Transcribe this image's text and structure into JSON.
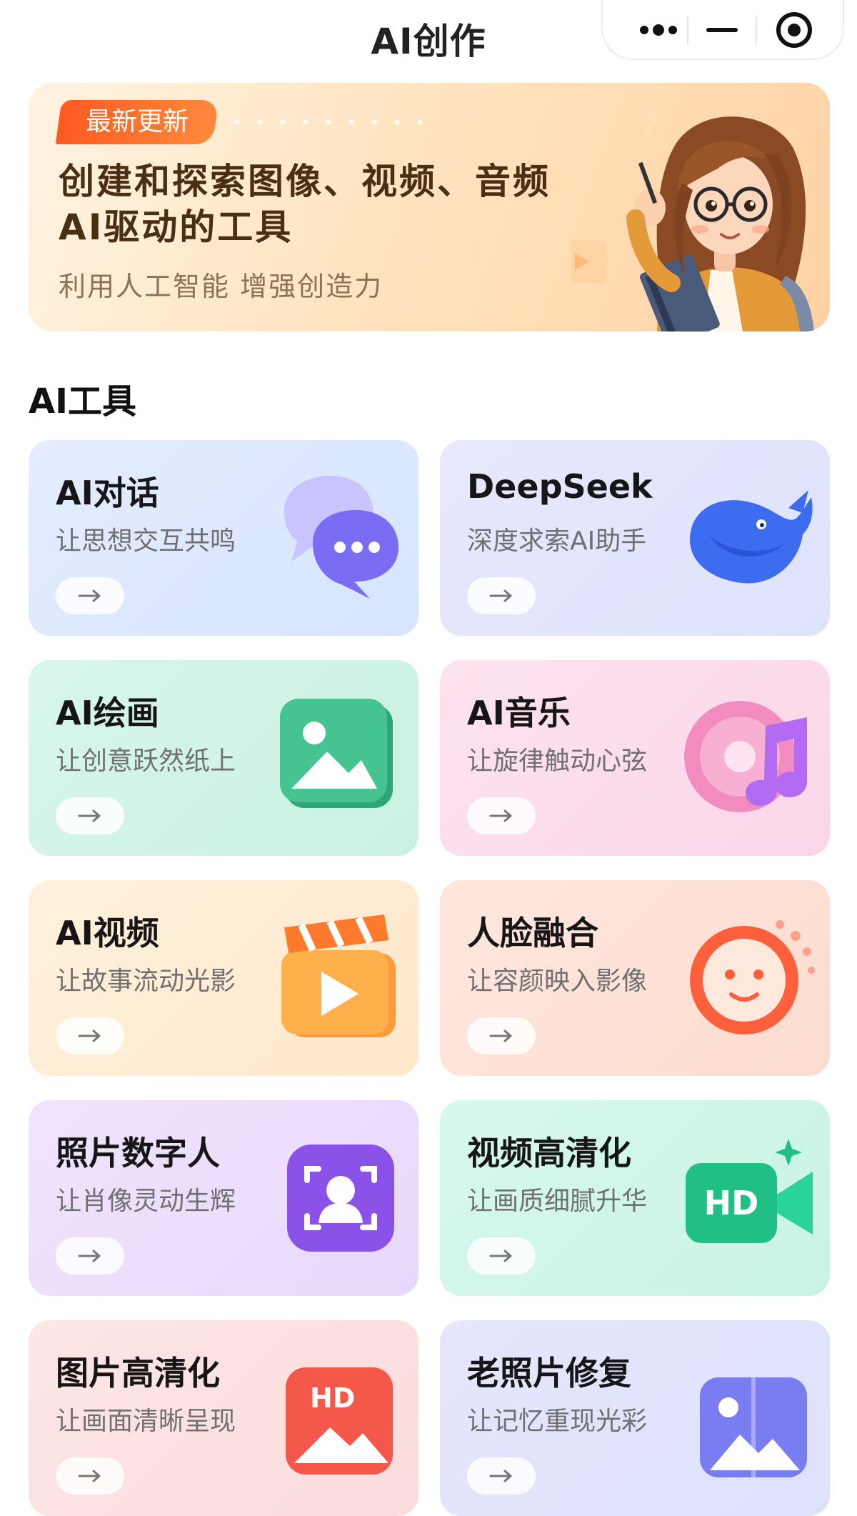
{
  "header": {
    "title": "AI创作",
    "capsule": {
      "more_icon": "more-dots-icon",
      "minimize_icon": "minimize-icon",
      "close_icon": "target-close-icon"
    }
  },
  "banner": {
    "badge": "最新更新",
    "title_line1": "创建和探索图像、视频、音频",
    "title_line2": "AI驱动的工具",
    "subtitle": "利用人工智能 增强创造力",
    "illustration": "girl-with-glasses-illustration"
  },
  "section": {
    "title": "AI工具"
  },
  "tools": [
    {
      "title": "AI对话",
      "subtitle": "让思想交互共鸣",
      "icon": "chat-bubbles-icon",
      "bg": "#dfe9ff",
      "accent": "#7b6cf6"
    },
    {
      "title": "DeepSeek",
      "subtitle": "深度求索AI助手",
      "icon": "whale-icon",
      "bg": "#e4e6fd",
      "accent": "#3d6cf0"
    },
    {
      "title": "AI绘画",
      "subtitle": "让创意跃然纸上",
      "icon": "picture-icon",
      "bg": "#d8f5ea",
      "accent": "#3cbf8a"
    },
    {
      "title": "AI音乐",
      "subtitle": "让旋律触动心弦",
      "icon": "music-disc-icon",
      "bg": "#fbe0ee",
      "accent": "#e75fa6"
    },
    {
      "title": "AI视频",
      "subtitle": "让故事流动光影",
      "icon": "clapper-play-icon",
      "bg": "#fff0da",
      "accent": "#ff8a2a"
    },
    {
      "title": "人脸融合",
      "subtitle": "让容颜映入影像",
      "icon": "face-icon",
      "bg": "#ffe6dc",
      "accent": "#ff5f3a"
    },
    {
      "title": "照片数字人",
      "subtitle": "让肖像灵动生辉",
      "icon": "portrait-scan-icon",
      "bg": "#efe2fb",
      "accent": "#8a52e8"
    },
    {
      "title": "视频高清化",
      "subtitle": "让画质细腻升华",
      "icon": "hd-video-icon",
      "bg": "#d9f7ef",
      "accent": "#1fbf86"
    },
    {
      "title": "图片高清化",
      "subtitle": "让画面清晰呈现",
      "icon": "hd-picture-icon",
      "bg": "#fde3e3",
      "accent": "#f4584a"
    },
    {
      "title": "老照片修复",
      "subtitle": "让记忆重现光彩",
      "icon": "old-photo-icon",
      "bg": "#e4e6fb",
      "accent": "#7a7cf2"
    }
  ],
  "arrow_label": "→",
  "hd_label": "HD"
}
